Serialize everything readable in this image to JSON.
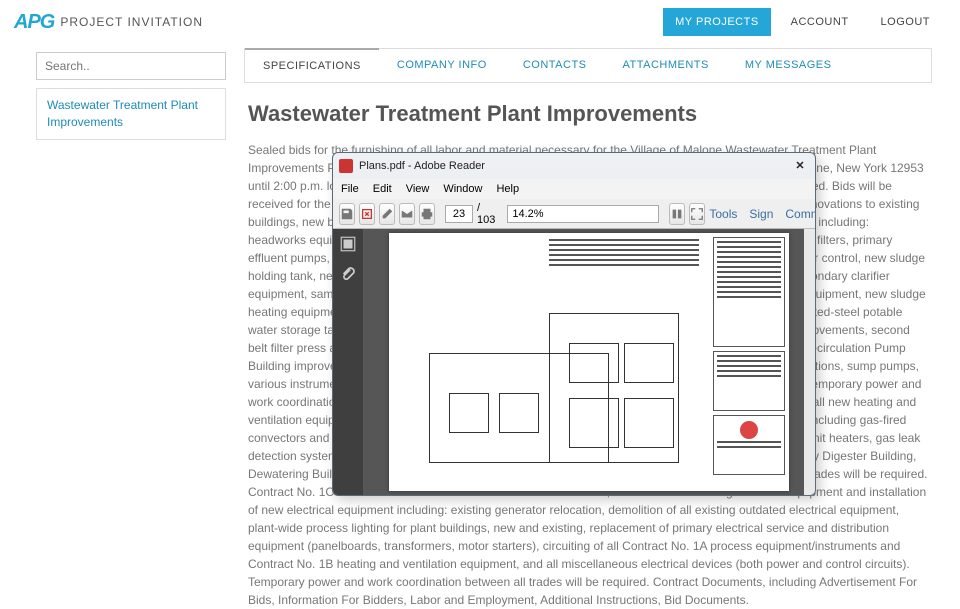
{
  "header": {
    "logo": "APG",
    "logo_sub": "PROJECT INVITATION",
    "nav": {
      "my_projects": "MY PROJECTS",
      "account": "ACCOUNT",
      "logout": "LOGOUT"
    }
  },
  "sidebar": {
    "search_placeholder": "Search..",
    "project_link": "Wastewater Treatment Plant Improvements"
  },
  "tabs": {
    "specifications": "SPECIFICATIONS",
    "company_info": "COMPANY INFO",
    "contacts": "CONTACTS",
    "attachments": "ATTACHMENTS",
    "my_messages": "MY MESSAGES"
  },
  "page": {
    "title": "Wastewater Treatment Plant Improvements",
    "body": "Sealed bids for the furnishing of all labor and material necessary for the Village of Malone Wastewater Treatment Plant Improvements Project will be received by the Village of Malone at the Village Offices at 14 Elm Street, Malone, New York 12953 until 2:00 p.m. local time on Thursday, June 28, 2012, at which time and place all bids will be publicly opened. Bids will be received for the following Contracts: Contract No. 1A – General Construction: Work includes demolition, renovations to existing buildings, new building construction, Operations Building renovations and installation of process equipment including: headworks equipment, RAS/WAS pumps, neutralization equipment, rehabilitations to existing effluent sand filters, primary effluent pumps, primary digester renovations and tank improvements, scum handling, WAS thickening, odor control, new sludge holding tank, new motor contactor equipment including: new influent channel monster standby screen, secondary clarifier equipment, samplers, new secondary clarifier tank, Preliminary Treatment Building renovations and new equipment, new sludge heating equipment, miscellaneous heating improvements, septage receiving improvements, glass-lined bolted-steel potable water storage tank, WAS pumps, drain pumps, filter washwater recycle pump, existing belt filter press improvements, second belt filter press and equipment, Main Pump Building renovations, Primary Digester Building renovations, Recirculation Pump Building improvements, Preliminary Building renovations, Secondary Clarifier renovations, clearwell renovations, sump pumps, various instrumentation and controls, electrical improvements and heating and ventilation improvements. Temporary power and work coordination between all trades will be required. Heating and Ventilating Construction: Work includes all new heating and ventilation equipment and ductwork for the Village of Malone Wastewater Treatment Plant Improvements, including gas-fired convectors and gas-fired hot water boilers, recirculation fans (ceiling fans), gas fired unit heaters, electric unit heaters, gas leak detection systems, air handling equipment and exhaust fans for Operations Building improvements, Primary Digester Building, Dewatering Building, and Preliminary Treatment Building. Temporary power and coordination between all trades will be required. Contract No. 1C – Electrical Construction: Work includes demolition, renovations of existing electrical equipment and installation of new electrical equipment including: existing generator relocation, demolition of all existing outdated electrical equipment, plant-wide process lighting for plant buildings, new and existing, replacement of primary electrical service and distribution equipment (panelboards, transformers, motor starters), circuiting of all Contract No. 1A process equipment/instruments and Contract No. 1B heating and ventilation equipment, and all miscellaneous electrical devices (both power and control circuits). Temporary power and work coordination between all trades will be required. Contract Documents, including Advertisement For Bids, Information For Bidders, Labor and Employment, Additional Instructions, Bid Documents."
  },
  "pdf": {
    "title": "Plans.pdf - Adobe Reader",
    "menus": {
      "file": "File",
      "edit": "Edit",
      "view": "View",
      "window": "Window",
      "help": "Help"
    },
    "page_current": "23",
    "page_total": "/ 103",
    "zoom": "14.2%",
    "actions": {
      "tools": "Tools",
      "sign": "Sign",
      "comment": "Comment"
    }
  }
}
